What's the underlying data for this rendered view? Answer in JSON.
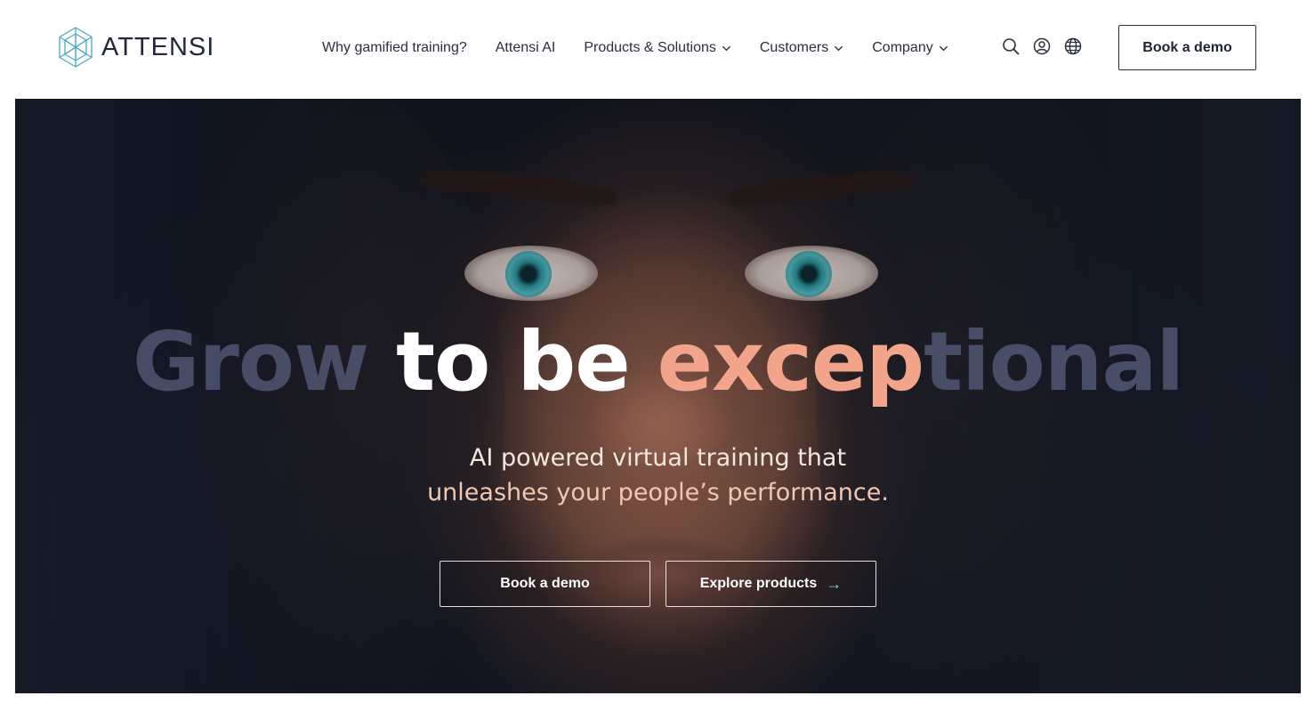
{
  "brand": {
    "name": "ATTENSI",
    "logo_icon": "hexagon-cube-logo-icon",
    "accent": "#4aa8c8"
  },
  "nav": {
    "items": [
      {
        "label": "Why gamified training?",
        "has_dropdown": false
      },
      {
        "label": "Attensi AI",
        "has_dropdown": false
      },
      {
        "label": "Products & Solutions",
        "has_dropdown": true
      },
      {
        "label": "Customers",
        "has_dropdown": true
      },
      {
        "label": "Company",
        "has_dropdown": true
      }
    ],
    "utility_icons": [
      "search-icon",
      "account-icon",
      "globe-icon"
    ],
    "cta_label": "Book a demo"
  },
  "hero": {
    "headline_words": [
      "Grow",
      "to be",
      "exceptional",
      ""
    ],
    "headline_parts": {
      "w1": "Grow ",
      "w2": "to be ",
      "w3": "excep",
      "w4": "tional"
    },
    "subline_line1": "AI powered virtual training that",
    "subline_line2": "unleashes your people’s performance.",
    "primary_button": "Book a demo",
    "secondary_button": "Explore products",
    "secondary_button_icon": "arrow-right-icon",
    "colors": {
      "headline_highlight": "#f3a58c",
      "headline_muted": "#5a6080",
      "background": "#13161f"
    }
  }
}
